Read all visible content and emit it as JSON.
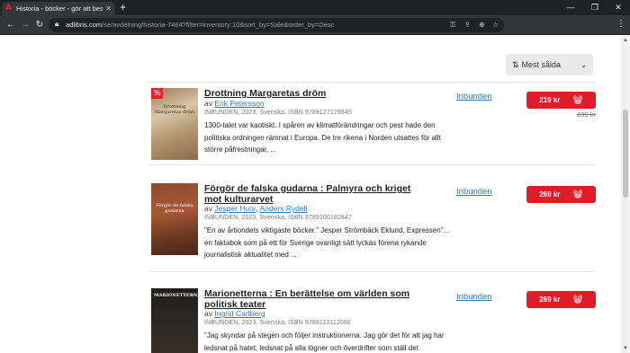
{
  "browser": {
    "tab_title": "Historia - böcker - gör att bestäl",
    "tab_close": "✕",
    "new_tab": "+",
    "url_host": "adlibris.com",
    "url_path": "/se/avdelning/historia-7464?filter=inventory:10&sort_by=Sale&order_by=Desc",
    "window_controls": [
      "—",
      "❐",
      "✕"
    ]
  },
  "sort": {
    "label": "Mest sålda"
  },
  "products": [
    {
      "title": "Drottning Margaretas dröm",
      "by": "av",
      "authors": [
        "Erik Petersson"
      ],
      "meta": "INBUNDEN, 2023, Svenska, ISBN 9789127176645",
      "description": "1300-talet var kaotiskt. I spåren av klimatförändringar och pest hade den politiska ordningen rämnat i Europa. De tre rikena i Norden utsattes för allt större påfrestningar, ...",
      "format": "Inbunden",
      "price": "219 kr",
      "old_price": "239 kr",
      "badge": "%",
      "cover_text": "Drottning Margaretas dröm"
    },
    {
      "title": "Förgör de falska gudarna : Palmyra och kriget mot kulturarvet",
      "by": "av",
      "authors": [
        "Jesper Huor",
        "Anders Rydell"
      ],
      "meta": "INBUNDEN, 2023, Svenska, ISBN 9789100182847",
      "description": "\"En av årtiondets viktigaste böcker.\" Jesper Strömbäck Eklund, Expressen\"... en faktabok som på ett för Sverige ovanligt sätt lyckas förena rykande journalistisk aktualitet med ...",
      "format": "Inbunden",
      "price": "269 kr",
      "cover_text": "Förgör de falska gudarna"
    },
    {
      "title": "Marionetterna : En berättelse om världen som politisk teater",
      "by": "av",
      "authors": [
        "Ingrid Carlberg"
      ],
      "meta": "INBUNDEN, 2023, Svenska, ISBN 9789113112060",
      "description": "\"Jag skyndar på stegen och följer instruktionerna. Jag gör det för att jag har ledsnat på hatet, ledsnat på alla lögner och överdrifter som ställ det",
      "format": "Inbunden",
      "price": "269 kr",
      "cover_text": "MARIONETTERNA"
    }
  ],
  "colors": {
    "buy": "#e21b28",
    "link": "#2a7ab8",
    "tab_bg": "#202124"
  },
  "icons": {
    "cart": "shopping-basket-icon",
    "sort": "sort-arrows-icon"
  }
}
